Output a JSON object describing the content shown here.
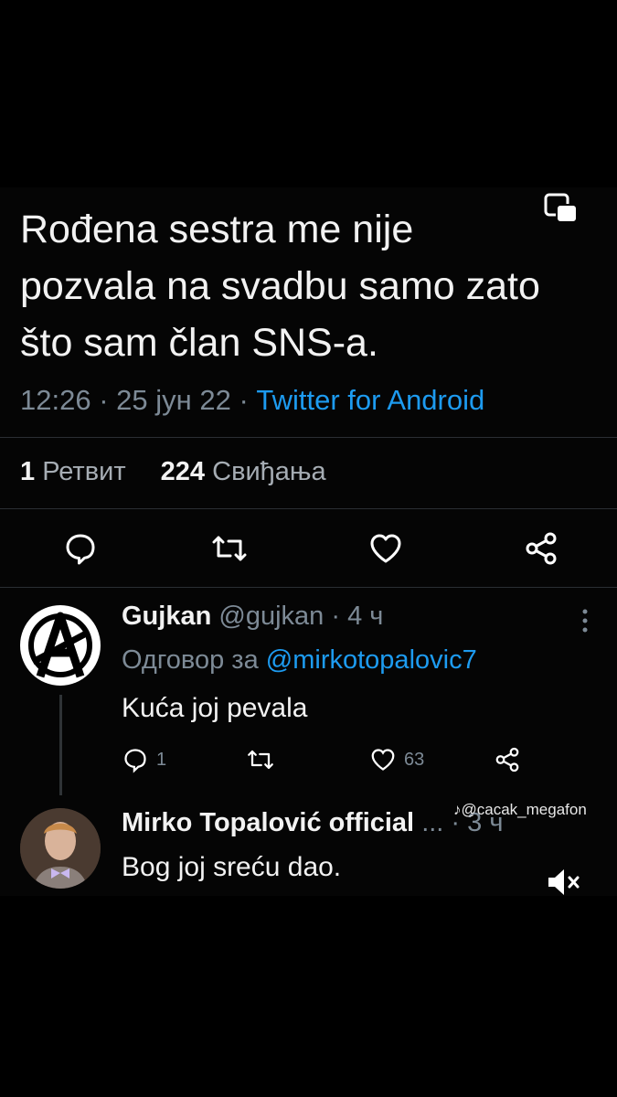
{
  "tweet": {
    "text": "Rođena sestra me nije pozvala na svadbu samo zato što sam član SNS-a.",
    "time": "12:26",
    "date": "25 јун 22",
    "source": "Twitter for Android",
    "retweet_count": "1",
    "retweet_label": "Ретвит",
    "like_count": "224",
    "like_label": "Свиђања"
  },
  "reply1": {
    "name": "Gujkan",
    "handle": "@gujkan",
    "time": "4 ч",
    "reply_prefix": "Одговор за",
    "reply_to": "@mirkotopalovic7",
    "text": "Kuća joj pevala",
    "reply_count": "1",
    "like_count": "63"
  },
  "reply2": {
    "name": "Mirko Topalović official",
    "ellipsis": "...",
    "time": "3 ч",
    "text": "Bog joj sreću dao."
  },
  "watermark": {
    "text": "@cacak_megafon"
  },
  "icons": {
    "copy": "copy-icon",
    "reply": "reply-icon",
    "retweet": "retweet-icon",
    "like": "heart-icon",
    "share": "share-icon",
    "more": "more-icon",
    "mute": "mute-icon"
  },
  "colors": {
    "link": "#1d9bf0",
    "muted": "#7d8a96",
    "background": "#000000"
  }
}
